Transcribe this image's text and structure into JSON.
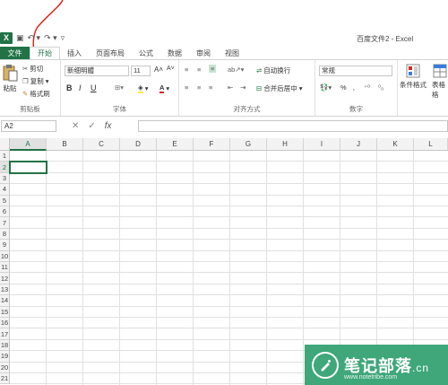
{
  "window": {
    "title": "百度文件2 - Excel"
  },
  "qat": {
    "app_icon": "X",
    "save": "▣",
    "undo": "↶ ▾",
    "redo": "↷ ▾",
    "more": "▿"
  },
  "tabs": [
    "文件",
    "开始",
    "插入",
    "页面布局",
    "公式",
    "数据",
    "审阅",
    "视图"
  ],
  "clipboard": {
    "paste": "粘贴",
    "cut": "剪切",
    "copy": "复制",
    "format_painter": "格式刷",
    "label": "剪贴板"
  },
  "font": {
    "name": "新细明體",
    "size": "11",
    "grow": "A˄",
    "shrink": "A˅",
    "bold": "B",
    "italic": "I",
    "underline": "U",
    "label": "字体"
  },
  "alignment": {
    "wrap": "自动换行",
    "merge": "合并后居中",
    "label": "对齐方式"
  },
  "number": {
    "format": "常规",
    "percent": "%",
    "comma": "‚",
    "label": "数字"
  },
  "styles": {
    "conditional": "条件格式",
    "table_format": "套用\n表格格",
    "table_line2": "表格格"
  },
  "formula_bar": {
    "name_box": "A2",
    "cancel": "✕",
    "enter": "✓",
    "fx": "fx",
    "value": ""
  },
  "columns": [
    "A",
    "B",
    "C",
    "D",
    "E",
    "F",
    "G",
    "H",
    "I",
    "J",
    "K",
    "L"
  ],
  "rows": [
    "1",
    "2",
    "3",
    "4",
    "5",
    "6",
    "7",
    "8",
    "9",
    "10",
    "11",
    "12",
    "13",
    "14",
    "15",
    "16",
    "17",
    "18",
    "19",
    "20",
    "21"
  ],
  "active_cell": "A2",
  "watermark": {
    "text": "笔记部落",
    "suffix": ".cn",
    "url": "www.notetribe.com"
  },
  "colors": {
    "accent": "#217346",
    "watermark": "#3fa77a",
    "annotation": "#d9271e"
  }
}
